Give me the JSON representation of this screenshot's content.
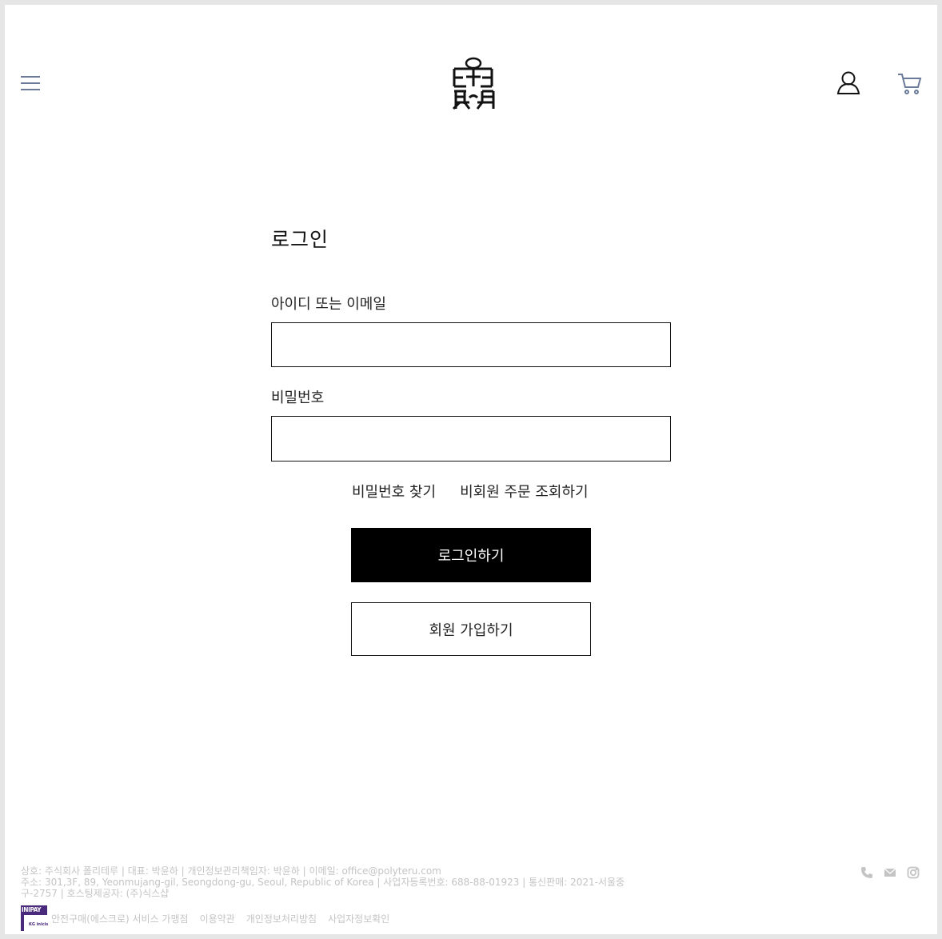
{
  "header": {
    "menu_icon": "hamburger-menu-icon",
    "logo_icon": "brand-logo",
    "account_icon": "user-icon",
    "cart_icon": "cart-icon"
  },
  "login": {
    "title": "로그인",
    "id_label": "아이디 또는 이메일",
    "id_value": "",
    "password_label": "비밀번호",
    "password_value": "",
    "find_password": "비밀번호 찾기",
    "guest_order": "비회원 주문 조회하기",
    "login_button": "로그인하기",
    "signup_button": "회원 가입하기"
  },
  "footer": {
    "info_line1": "상호: 주식회사 폴리테루 | 대표: 박윤하 | 개인정보관리책임자: 박윤하 | 이메일: office@polyteru.com",
    "info_line2": "주소: 301,3F, 89, Yeonmujang-gil, Seongdong-gu, Seoul, Republic of Korea | 사업자등록번호: 688-88-01923 | 통신판매: 2021-서울중",
    "info_line3": "구-2757 | 호스팅제공자: (주)식스샵",
    "inipay_badge": "INIPAY",
    "inipay_sub": "KG inicis",
    "escrow_text": "안전구매(에스크로) 서비스 가맹점",
    "terms": "이용약관",
    "privacy": "개인정보처리방침",
    "business_check": "사업자정보확인",
    "social_icons": [
      "phone-icon",
      "mail-icon",
      "instagram-icon"
    ]
  },
  "colors": {
    "accent_icon": "#6b7a99",
    "footer_text": "#c4c4c4",
    "button_primary": "#000000",
    "inipay": "#4a2a7c"
  }
}
